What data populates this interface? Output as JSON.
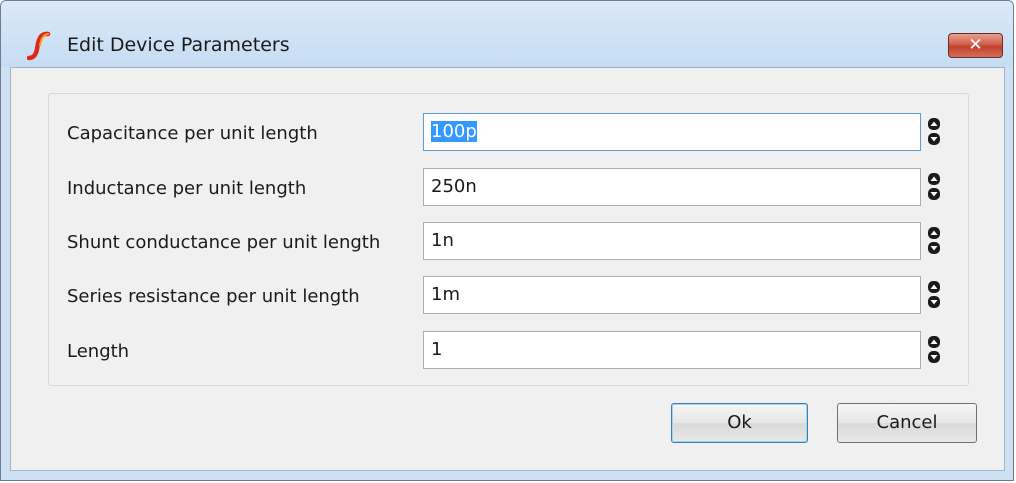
{
  "window": {
    "title": "Edit Device Parameters",
    "close_symbol": "✕",
    "app_icon": "simetrix-logo-icon"
  },
  "parameters": [
    {
      "label": "Capacitance per unit length",
      "value": "100p",
      "selected": true
    },
    {
      "label": "Inductance per unit length",
      "value": "250n",
      "selected": false
    },
    {
      "label": "Shunt conductance per unit length",
      "value": "1n",
      "selected": false
    },
    {
      "label": "Series resistance per unit length",
      "value": "1m",
      "selected": false
    },
    {
      "label": "Length",
      "value": "1",
      "selected": false
    }
  ],
  "buttons": {
    "ok_label": "Ok",
    "cancel_label": "Cancel"
  },
  "colors": {
    "selection": "#3399ff",
    "close_button": "#c0412b",
    "accent_logo": "#e0261b"
  }
}
